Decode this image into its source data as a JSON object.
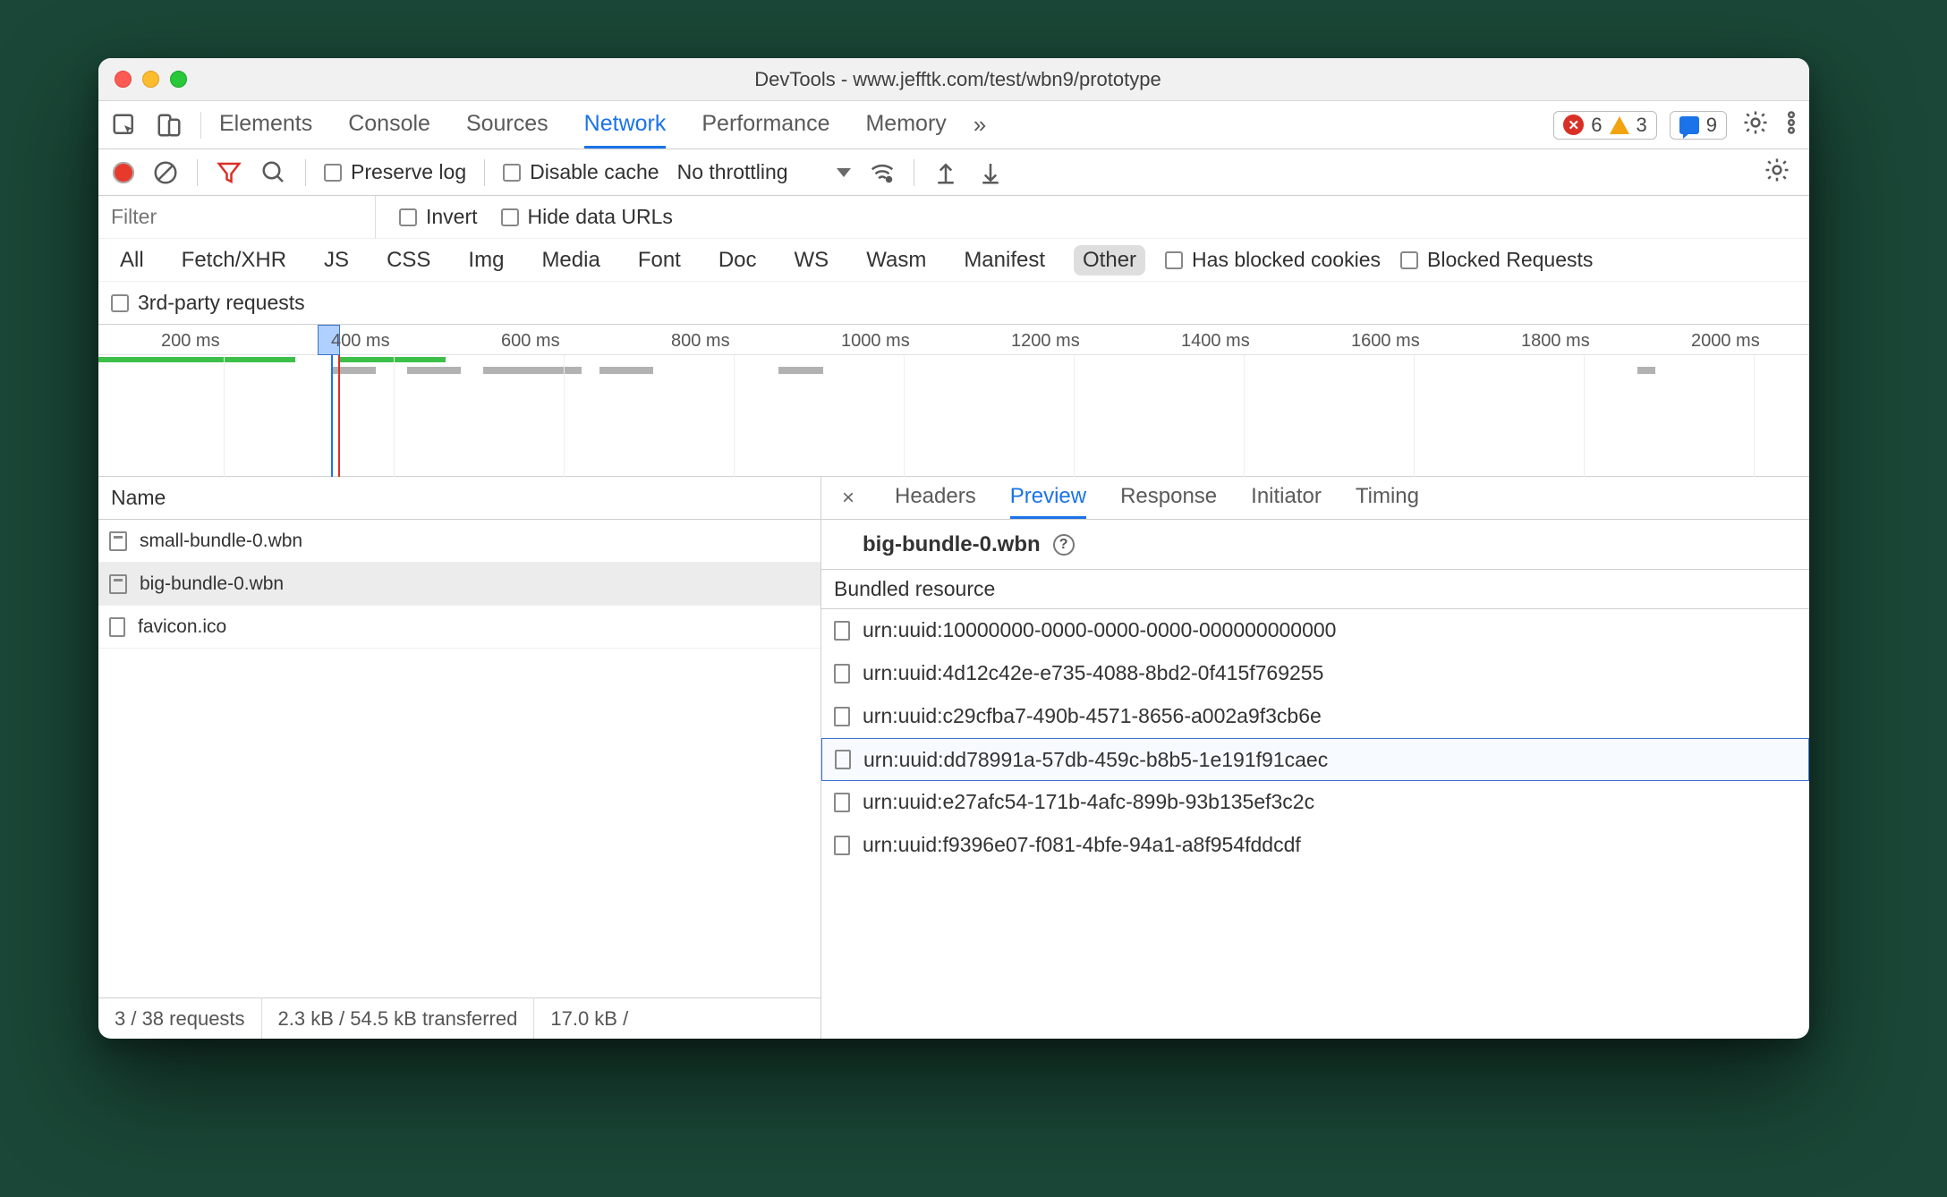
{
  "window": {
    "title": "DevTools - www.jefftk.com/test/wbn9/prototype"
  },
  "tabs": {
    "items": [
      "Elements",
      "Console",
      "Sources",
      "Network",
      "Performance",
      "Memory"
    ],
    "active": "Network",
    "overflow_glyph": "»"
  },
  "badges": {
    "errors": "6",
    "warnings": "3",
    "messages": "9"
  },
  "toolbar": {
    "preserve_log": "Preserve log",
    "disable_cache": "Disable cache",
    "throttling": "No throttling"
  },
  "filter": {
    "placeholder": "Filter",
    "invert": "Invert",
    "hide_data_urls": "Hide data URLs"
  },
  "types": {
    "items": [
      "All",
      "Fetch/XHR",
      "JS",
      "CSS",
      "Img",
      "Media",
      "Font",
      "Doc",
      "WS",
      "Wasm",
      "Manifest",
      "Other"
    ],
    "selected": "Other",
    "has_blocked_cookies": "Has blocked cookies",
    "blocked_requests": "Blocked Requests",
    "third_party": "3rd-party requests"
  },
  "timeline": {
    "ticks": [
      "200 ms",
      "400 ms",
      "600 ms",
      "800 ms",
      "1000 ms",
      "1200 ms",
      "1400 ms",
      "1600 ms",
      "1800 ms",
      "2000 ms"
    ]
  },
  "requests": {
    "col_name": "Name",
    "items": [
      {
        "name": "small-bundle-0.wbn",
        "icon": "bundle"
      },
      {
        "name": "big-bundle-0.wbn",
        "icon": "bundle",
        "selected": true
      },
      {
        "name": "favicon.ico",
        "icon": "doc"
      }
    ],
    "status": {
      "counts": "3 / 38 requests",
      "transferred": "2.3 kB / 54.5 kB transferred",
      "resources": "17.0 kB /"
    }
  },
  "detail": {
    "tabs": [
      "Headers",
      "Preview",
      "Response",
      "Initiator",
      "Timing"
    ],
    "active": "Preview",
    "title": "big-bundle-0.wbn",
    "section": "Bundled resource",
    "resources": [
      "urn:uuid:10000000-0000-0000-0000-000000000000",
      "urn:uuid:4d12c42e-e735-4088-8bd2-0f415f769255",
      "urn:uuid:c29cfba7-490b-4571-8656-a002a9f3cb6e",
      "urn:uuid:dd78991a-57db-459c-b8b5-1e191f91caec",
      "urn:uuid:e27afc54-171b-4afc-899b-93b135ef3c2c",
      "urn:uuid:f9396e07-f081-4bfe-94a1-a8f954fddcdf"
    ],
    "highlight_index": 3
  }
}
